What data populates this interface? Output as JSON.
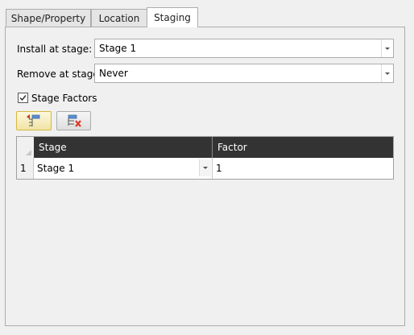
{
  "tabs": [
    {
      "label": "Shape/Property"
    },
    {
      "label": "Location"
    },
    {
      "label": "Staging"
    }
  ],
  "active_tab": "Staging",
  "staging": {
    "install_label": "Install at stage:",
    "install_value": "Stage 1",
    "remove_label": "Remove at stage:",
    "remove_value": "Never",
    "factors_checkbox_label": "Stage Factors",
    "factors_checked": true
  },
  "toolbar": {
    "add_icon": "insert-row-icon",
    "delete_icon": "delete-row-icon"
  },
  "table": {
    "headers": [
      "Stage",
      "Factor"
    ],
    "rows": [
      {
        "index": "1",
        "stage": "Stage 1",
        "factor": "1"
      }
    ]
  },
  "colors": {
    "header_bg": "#333333",
    "selected_button": "#f1e4a6",
    "delete_x": "#e03a2a"
  }
}
